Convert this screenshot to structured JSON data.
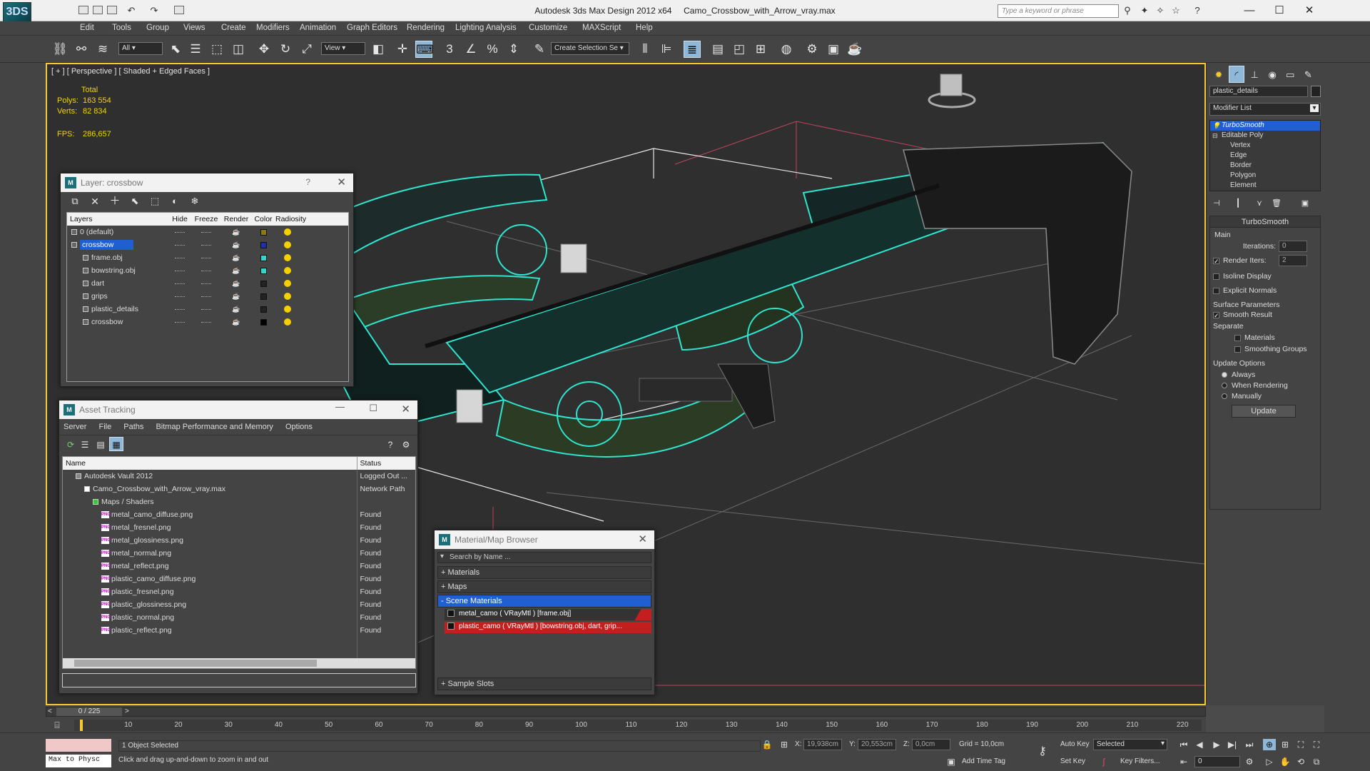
{
  "window": {
    "app_title": "Autodesk 3ds Max Design 2012 x64",
    "file_title": "Camo_Crossbow_with_Arrow_vray.max",
    "search_placeholder": "Type a keyword or phrase",
    "logo": "3DS"
  },
  "menu": [
    "Edit",
    "Tools",
    "Group",
    "Views",
    "Create",
    "Modifiers",
    "Animation",
    "Graph Editors",
    "Rendering",
    "Lighting Analysis",
    "Customize",
    "MAXScript",
    "Help"
  ],
  "toolbar": {
    "selection_filter": "All",
    "ref_coord": "View",
    "named_selection": "Create Selection Se"
  },
  "viewport": {
    "label": "[ + ] [ Perspective ] [ Shaded + Edged Faces ]",
    "stats_header": "Total",
    "polys_label": "Polys:",
    "polys_value": "163 554",
    "verts_label": "Verts:",
    "verts_value": "82 834",
    "fps_label": "FPS:",
    "fps_value": "286,657"
  },
  "layer_window": {
    "title": "Layer: crossbow",
    "columns": [
      "Layers",
      "Hide",
      "Freeze",
      "Render",
      "Color",
      "Radiosity"
    ],
    "rows": [
      {
        "name": "0 (default)",
        "color": "#8a7a10",
        "indent": 0,
        "selected": false
      },
      {
        "name": "crossbow",
        "color": "#1f2fa8",
        "indent": 0,
        "selected": true
      },
      {
        "name": "frame.obj",
        "color": "#35d6c9",
        "indent": 1,
        "selected": false
      },
      {
        "name": "bowstring.obj",
        "color": "#35d6c9",
        "indent": 1,
        "selected": false
      },
      {
        "name": "dart",
        "color": "#222222",
        "indent": 1,
        "selected": false
      },
      {
        "name": "grips",
        "color": "#222222",
        "indent": 1,
        "selected": false
      },
      {
        "name": "plastic_details",
        "color": "#222222",
        "indent": 1,
        "selected": false
      },
      {
        "name": "crossbow",
        "color": "#000000",
        "indent": 1,
        "selected": false
      }
    ]
  },
  "asset_window": {
    "title": "Asset Tracking",
    "menu": [
      "Server",
      "File",
      "Paths",
      "Bitmap Performance and Memory",
      "Options"
    ],
    "columns": [
      "Name",
      "Status"
    ],
    "rows": [
      {
        "name": "Autodesk Vault 2012",
        "status": "Logged Out ...",
        "indent": 1,
        "kind": "vault"
      },
      {
        "name": "Camo_Crossbow_with_Arrow_vray.max",
        "status": "Network Path",
        "indent": 2,
        "kind": "max"
      },
      {
        "name": "Maps / Shaders",
        "status": "",
        "indent": 3,
        "kind": "folder"
      },
      {
        "name": "metal_camo_diffuse.png",
        "status": "Found",
        "indent": 4,
        "kind": "png"
      },
      {
        "name": "metal_fresnel.png",
        "status": "Found",
        "indent": 4,
        "kind": "png"
      },
      {
        "name": "metal_glossiness.png",
        "status": "Found",
        "indent": 4,
        "kind": "png"
      },
      {
        "name": "metal_normal.png",
        "status": "Found",
        "indent": 4,
        "kind": "png"
      },
      {
        "name": "metal_reflect.png",
        "status": "Found",
        "indent": 4,
        "kind": "png"
      },
      {
        "name": "plastic_camo_diffuse.png",
        "status": "Found",
        "indent": 4,
        "kind": "png"
      },
      {
        "name": "plastic_fresnel.png",
        "status": "Found",
        "indent": 4,
        "kind": "png"
      },
      {
        "name": "plastic_glossiness.png",
        "status": "Found",
        "indent": 4,
        "kind": "png"
      },
      {
        "name": "plastic_normal.png",
        "status": "Found",
        "indent": 4,
        "kind": "png"
      },
      {
        "name": "plastic_reflect.png",
        "status": "Found",
        "indent": 4,
        "kind": "png"
      }
    ]
  },
  "material_browser": {
    "title": "Material/Map Browser",
    "search": "Search by Name ...",
    "groups": [
      "+ Materials",
      "+ Maps",
      "- Scene Materials"
    ],
    "materials": [
      {
        "name": "metal_camo  ( VRayMtl )  [frame.obj]",
        "selected": false
      },
      {
        "name": "plastic_camo  ( VRayMtl )  [bowstring.obj, dart, grip...",
        "selected": true
      }
    ],
    "sample_slots": "+ Sample Slots"
  },
  "command_panel": {
    "object_name": "plastic_details",
    "modifier_list": "Modifier List",
    "stack": [
      {
        "label": "TurboSmooth",
        "level": 0,
        "selected": true
      },
      {
        "label": "Editable Poly",
        "level": 0,
        "selected": false
      },
      {
        "label": "Vertex",
        "level": 1,
        "selected": false
      },
      {
        "label": "Edge",
        "level": 1,
        "selected": false
      },
      {
        "label": "Border",
        "level": 1,
        "selected": false
      },
      {
        "label": "Polygon",
        "level": 1,
        "selected": false
      },
      {
        "label": "Element",
        "level": 1,
        "selected": false
      }
    ],
    "rollout_title": "TurboSmooth",
    "main_label": "Main",
    "iterations_label": "Iterations:",
    "iterations_value": "0",
    "render_iters_label": "Render Iters:",
    "render_iters_value": "2",
    "isoline_label": "Isoline Display",
    "explicit_normals_label": "Explicit Normals",
    "surface_params_label": "Surface Parameters",
    "smooth_result_label": "Smooth Result",
    "separate_label": "Separate",
    "materials_label": "Materials",
    "smoothing_groups_label": "Smoothing Groups",
    "update_options_label": "Update Options",
    "always_label": "Always",
    "when_rendering_label": "When Rendering",
    "manually_label": "Manually",
    "update_button": "Update"
  },
  "timeline": {
    "frame_display": "0 / 225",
    "ticks": [
      "10",
      "20",
      "30",
      "40",
      "50",
      "60",
      "70",
      "80",
      "90",
      "100",
      "110",
      "120",
      "130",
      "140",
      "150",
      "160",
      "170",
      "180",
      "190",
      "200",
      "210",
      "220"
    ]
  },
  "status": {
    "maxscript": "Max to Physc",
    "selected": "1 Object Selected",
    "prompt": "Click and drag up-and-down to zoom in and out",
    "x_label": "X:",
    "x_value": "19,938cm",
    "y_label": "Y:",
    "y_value": "20,553cm",
    "z_label": "Z:",
    "z_value": "0,0cm",
    "grid": "Grid = 10,0cm",
    "add_time_tag": "Add Time Tag",
    "auto_key": "Auto Key",
    "set_key": "Set Key",
    "key_mode": "Selected",
    "key_filters": "Key Filters...",
    "frame_field": "0"
  },
  "colors": {
    "viewport_border": "#f5c932",
    "wire": "#2ee6cf",
    "selection_blue": "#1f5fd1",
    "material_red": "#c41f1f"
  }
}
